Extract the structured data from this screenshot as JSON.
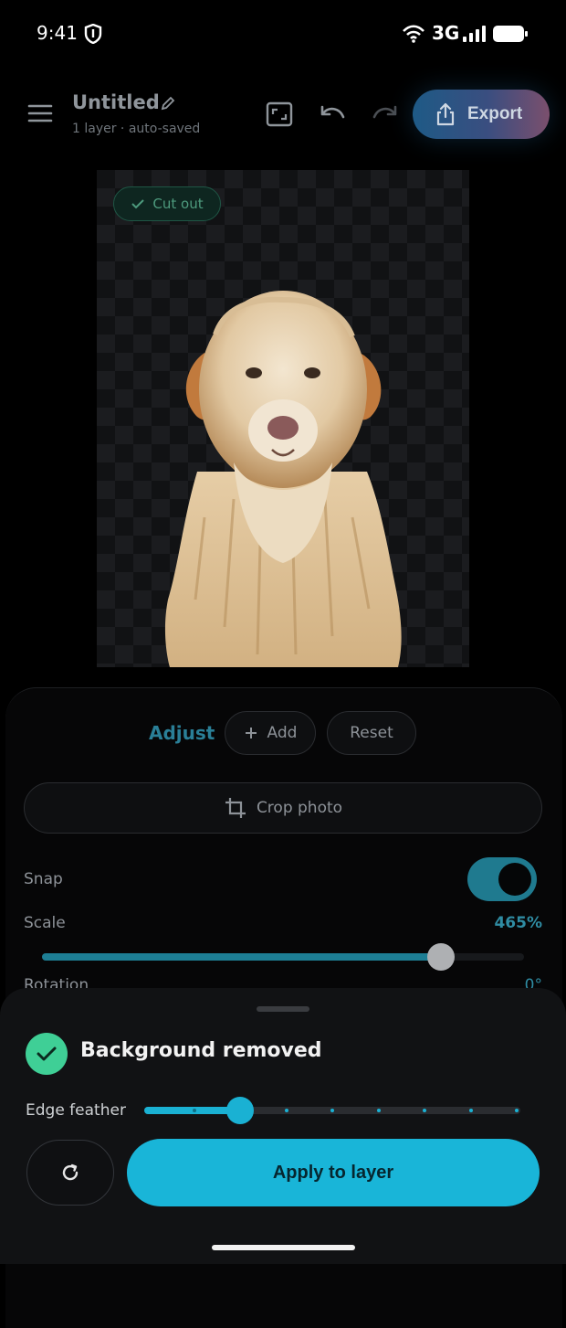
{
  "status_bar": {
    "time": "9:41",
    "network": "3G",
    "icons": [
      "shield-icon",
      "wifi-icon",
      "signal-icon",
      "battery-icon"
    ]
  },
  "header": {
    "title": "Untitled",
    "subtitle": "1 layer · auto-saved",
    "export_label": "Export",
    "icons": [
      "menu-icon",
      "edit-pencil-icon",
      "fit-screen-icon",
      "undo-icon",
      "redo-icon",
      "share-icon"
    ]
  },
  "canvas": {
    "badge_label": "Cut out"
  },
  "adjust_panel": {
    "active_tab": "Adjust",
    "add_label": "Add",
    "reset_label": "Reset",
    "crop_label": "Crop photo",
    "snap_label": "Snap",
    "snap_on": true,
    "scale_label": "Scale",
    "scale_value": "465%",
    "scale_fraction": 0.828,
    "rotation_label": "Rotation",
    "rotation_value": "0°"
  },
  "sheet": {
    "title": "Background removed",
    "feather_label": "Edge feather",
    "feather_fraction": 0.255,
    "feather_steps": 9,
    "apply_label": "Apply to layer"
  },
  "colors": {
    "accent": "#19b5d8",
    "success": "#3fcf96",
    "toggle_on": "#1f7a8f"
  }
}
